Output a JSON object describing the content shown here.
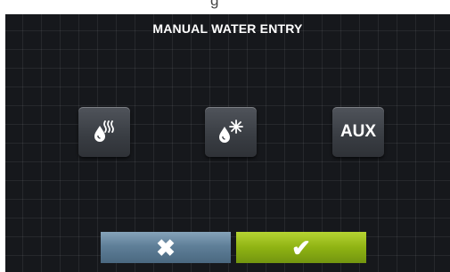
{
  "top_strip": {
    "partial_text": "g"
  },
  "screen": {
    "title": "MANUAL WATER ENTRY",
    "buttons": [
      {
        "name": "hot-water",
        "icon": "hot-water-drop-icon"
      },
      {
        "name": "cold-water",
        "icon": "cold-water-drop-icon"
      },
      {
        "name": "aux",
        "label": "AUX"
      }
    ],
    "actions": {
      "cancel_glyph": "✖",
      "confirm_glyph": "✔"
    }
  },
  "colors": {
    "background": "#16181c",
    "button": "#3a3e44",
    "cancel": "#5f7f98",
    "confirm": "#8fb313"
  }
}
